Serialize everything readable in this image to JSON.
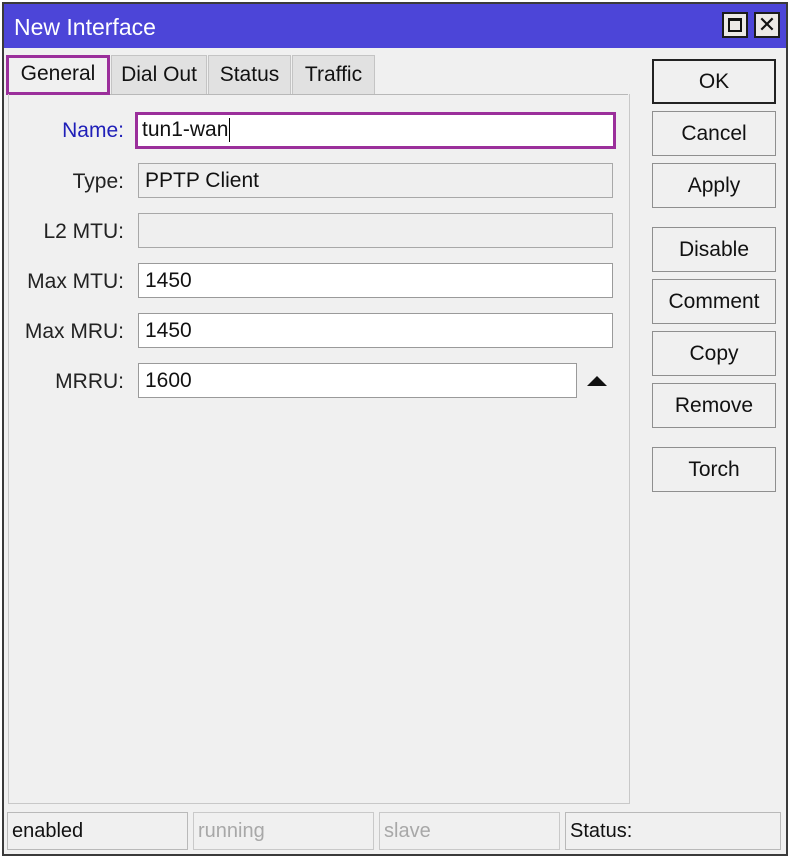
{
  "window": {
    "title": "New Interface"
  },
  "titlebar_buttons": {
    "maximize_icon": "maximize-icon",
    "close_icon": "close-icon",
    "close_glyph": "✕"
  },
  "tabs": [
    {
      "label": "General",
      "active": true
    },
    {
      "label": "Dial Out",
      "active": false
    },
    {
      "label": "Status",
      "active": false
    },
    {
      "label": "Traffic",
      "active": false
    }
  ],
  "form": {
    "name": {
      "label": "Name:",
      "value": "tun1-wan"
    },
    "type": {
      "label": "Type:",
      "value": "PPTP Client"
    },
    "l2mtu": {
      "label": "L2 MTU:",
      "value": ""
    },
    "max_mtu": {
      "label": "Max MTU:",
      "value": "1450"
    },
    "max_mru": {
      "label": "Max MRU:",
      "value": "1450"
    },
    "mrru": {
      "label": "MRRU:",
      "value": "1600"
    }
  },
  "buttons": {
    "ok": "OK",
    "cancel": "Cancel",
    "apply": "Apply",
    "disable": "Disable",
    "comment": "Comment",
    "copy": "Copy",
    "remove": "Remove",
    "torch": "Torch"
  },
  "status_bar": {
    "enabled": "enabled",
    "running": "running",
    "slave": "slave",
    "status": "Status:"
  },
  "colors": {
    "titlebar": "#4c45d8",
    "highlight": "#9b2f9b",
    "name_label": "#1f1fb8"
  }
}
